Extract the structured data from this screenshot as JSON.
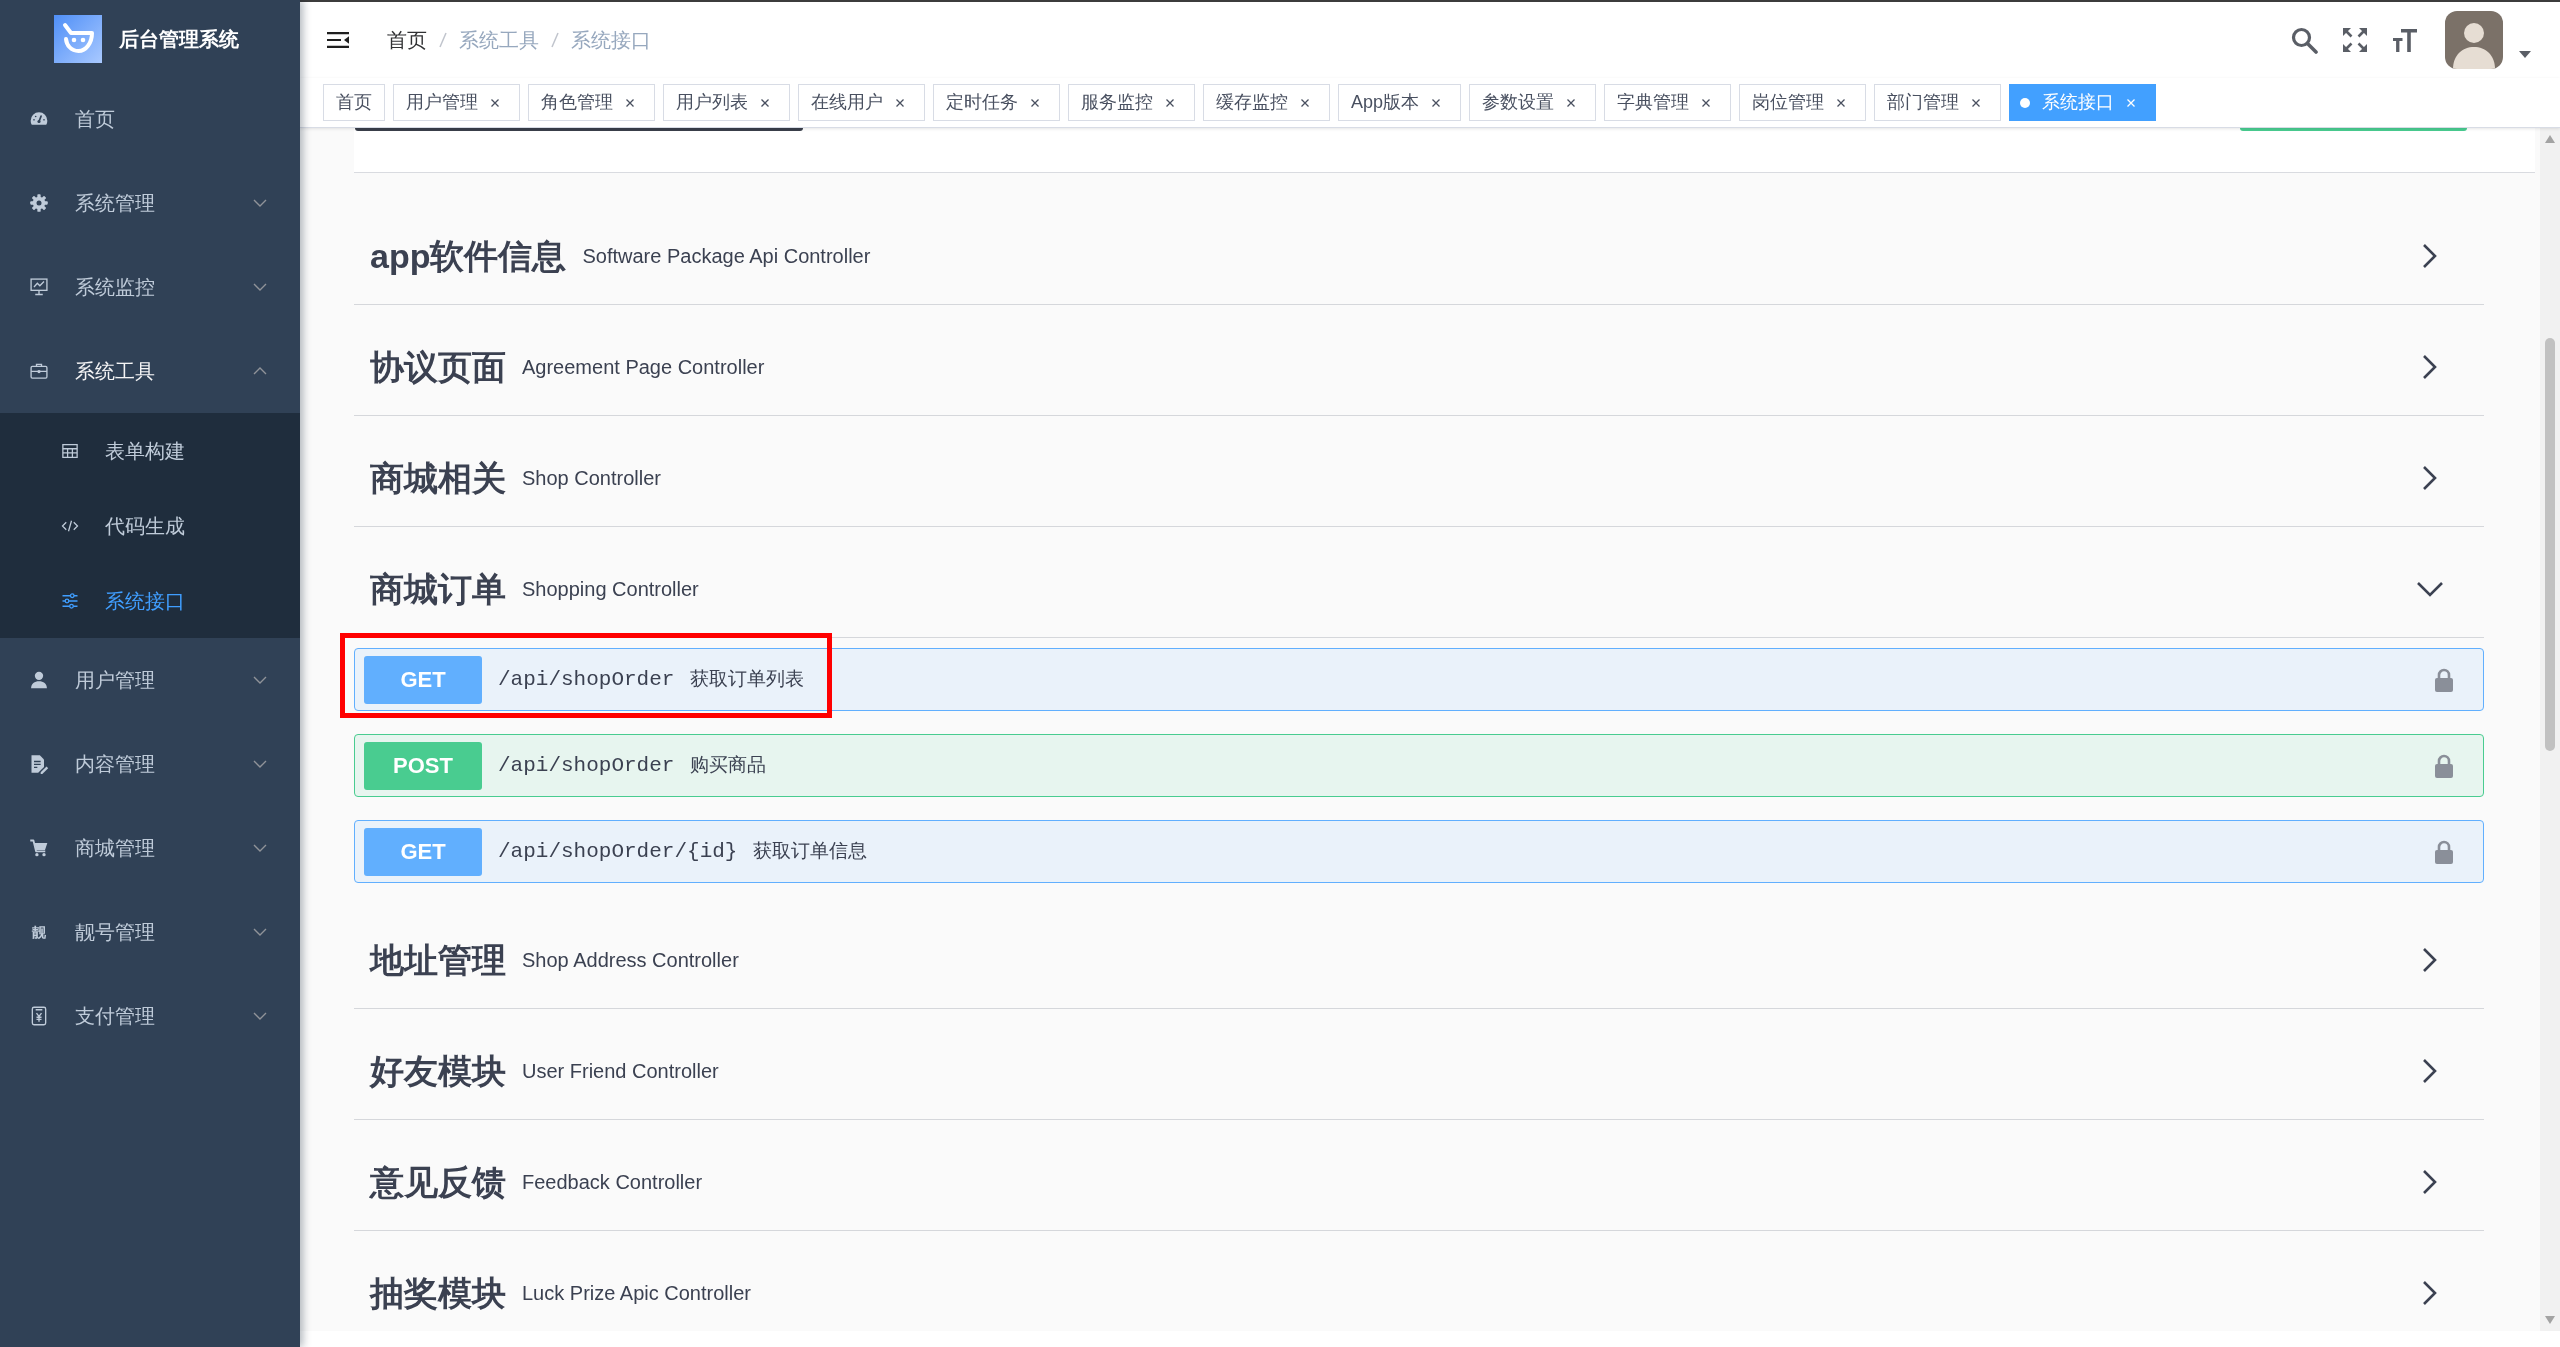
{
  "sidebar": {
    "title": "后台管理系统",
    "items": [
      {
        "label": "首页",
        "kind": "link",
        "selected": false,
        "expanded": false
      },
      {
        "label": "系统管理",
        "kind": "submenu",
        "selected": false,
        "expanded": false
      },
      {
        "label": "系统监控",
        "kind": "submenu",
        "selected": false,
        "expanded": false
      },
      {
        "label": "系统工具",
        "kind": "submenu",
        "selected": false,
        "expanded": true,
        "children": [
          {
            "label": "表单构建",
            "selected": false
          },
          {
            "label": "代码生成",
            "selected": false
          },
          {
            "label": "系统接口",
            "selected": true
          }
        ]
      },
      {
        "label": "用户管理",
        "kind": "submenu",
        "selected": false,
        "expanded": false
      },
      {
        "label": "内容管理",
        "kind": "submenu",
        "selected": false,
        "expanded": false
      },
      {
        "label": "商城管理",
        "kind": "submenu",
        "selected": false,
        "expanded": false
      },
      {
        "label": "靓号管理",
        "kind": "submenu",
        "selected": false,
        "expanded": false,
        "icon_text": "靓"
      },
      {
        "label": "支付管理",
        "kind": "submenu",
        "selected": false,
        "expanded": false
      }
    ]
  },
  "header": {
    "breadcrumb": [
      {
        "label": "首页",
        "link": true
      },
      {
        "label": "系统工具",
        "link": false
      },
      {
        "label": "系统接口",
        "link": false
      }
    ]
  },
  "tags": [
    {
      "label": "首页",
      "selected": false,
      "closable": false
    },
    {
      "label": "用户管理",
      "selected": false,
      "closable": true
    },
    {
      "label": "角色管理",
      "selected": false,
      "closable": true
    },
    {
      "label": "用户列表",
      "selected": false,
      "closable": true
    },
    {
      "label": "在线用户",
      "selected": false,
      "closable": true
    },
    {
      "label": "定时任务",
      "selected": false,
      "closable": true
    },
    {
      "label": "服务监控",
      "selected": false,
      "closable": true
    },
    {
      "label": "缓存监控",
      "selected": false,
      "closable": true
    },
    {
      "label": "App版本",
      "selected": false,
      "closable": true
    },
    {
      "label": "参数设置",
      "selected": false,
      "closable": true
    },
    {
      "label": "字典管理",
      "selected": false,
      "closable": true
    },
    {
      "label": "岗位管理",
      "selected": false,
      "closable": true
    },
    {
      "label": "部门管理",
      "selected": false,
      "closable": true
    },
    {
      "label": "系统接口",
      "selected": true,
      "closable": true
    }
  ],
  "sections": [
    {
      "title": "app软件信息",
      "description": "Software Package Api Controller",
      "expanded": false
    },
    {
      "title": "协议页面",
      "description": "Agreement Page Controller",
      "expanded": false
    },
    {
      "title": "商城相关",
      "description": "Shop Controller",
      "expanded": false
    },
    {
      "title": "商城订单",
      "description": "Shopping Controller",
      "expanded": true,
      "operations": [
        {
          "method": "GET",
          "path": "/api/shopOrder",
          "summary": "获取订单列表",
          "color": "#61affe",
          "highlighted": true
        },
        {
          "method": "POST",
          "path": "/api/shopOrder",
          "summary": "购买商品",
          "color": "#49cc90",
          "highlighted": false
        },
        {
          "method": "GET",
          "path": "/api/shopOrder/{id}",
          "summary": "获取订单信息",
          "color": "#61affe",
          "highlighted": false
        }
      ]
    },
    {
      "title": "地址管理",
      "description": "Shop Address Controller",
      "expanded": false
    },
    {
      "title": "好友模块",
      "description": "User Friend Controller",
      "expanded": false
    },
    {
      "title": "意见反馈",
      "description": "Feedback Controller",
      "expanded": false
    },
    {
      "title": "抽奖模块",
      "description": "Luck Prize Apic Controller",
      "expanded": false
    }
  ]
}
